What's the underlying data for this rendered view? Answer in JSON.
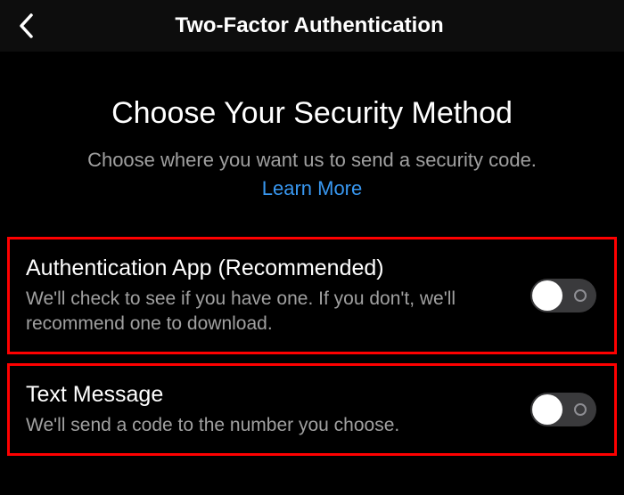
{
  "header": {
    "title": "Two-Factor Authentication"
  },
  "intro": {
    "heading": "Choose Your Security Method",
    "subtitle": "Choose where you want us to send a security code.",
    "learn_more": "Learn More"
  },
  "options": [
    {
      "title": "Authentication App (Recommended)",
      "desc": "We'll check to see if you have one. If you don't, we'll recommend one to download.",
      "on": false
    },
    {
      "title": "Text Message",
      "desc": "We'll send a code to the number you choose.",
      "on": false
    }
  ],
  "colors": {
    "link": "#3897f0",
    "highlight_border": "#ff0000"
  }
}
